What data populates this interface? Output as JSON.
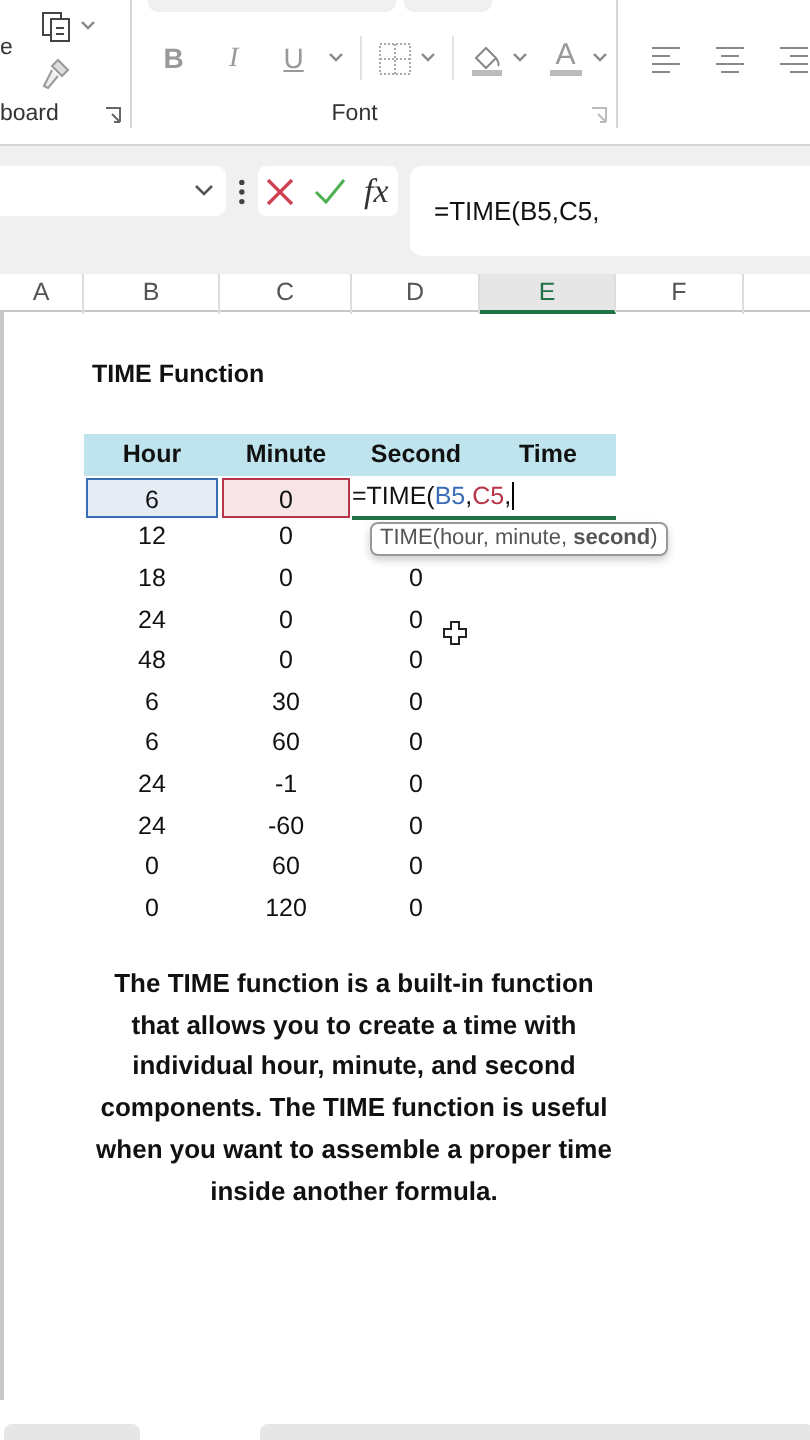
{
  "ribbon": {
    "clipboard_cut_label": "e",
    "clipboard_label": "board",
    "font_label": "Font",
    "font_buttons": [
      "B",
      "I",
      "U"
    ],
    "font_color_letter": "A"
  },
  "formula_bar": {
    "fx_label": "fx",
    "formula": "=TIME(B5,C5,"
  },
  "column_headers": [
    {
      "label": "A",
      "selected": false
    },
    {
      "label": "B",
      "selected": false
    },
    {
      "label": "C",
      "selected": false
    },
    {
      "label": "D",
      "selected": false
    },
    {
      "label": "E",
      "selected": true
    },
    {
      "label": "F",
      "selected": false
    }
  ],
  "sheet": {
    "title": "TIME Function",
    "columns": [
      "Hour",
      "Minute",
      "Second",
      "Time"
    ],
    "active_row": {
      "cells": [
        {
          "text": "6",
          "color": "#3a6db5"
        },
        {
          "text": "0",
          "color": "#b93448"
        }
      ],
      "formula_parts": [
        {
          "text": "=TIME("
        },
        {
          "text": "B5",
          "color": "#3a6db5"
        },
        {
          "text": ","
        },
        {
          "text": "C5",
          "color": "#b93448"
        },
        {
          "text": ","
        }
      ]
    },
    "tooltip": "TIME(hour, minute, **second**)",
    "rows": [
      [
        "12",
        "0"
      ],
      [
        "18",
        "0",
        "0"
      ],
      [
        "24",
        "0",
        "0"
      ],
      [
        "48",
        "0",
        "0"
      ],
      [
        "6",
        "30",
        "0"
      ],
      [
        "6",
        "60",
        "0"
      ],
      [
        "24",
        "-1",
        "0"
      ],
      [
        "24",
        "-60",
        "0"
      ],
      [
        "0",
        "60",
        "0"
      ],
      [
        "0",
        "120",
        "0"
      ]
    ],
    "description": "The TIME function is a built-in function that allows you to create a time with individual hour, minute, and second components. The TIME function is useful when you want to assemble a proper time inside another formula."
  }
}
